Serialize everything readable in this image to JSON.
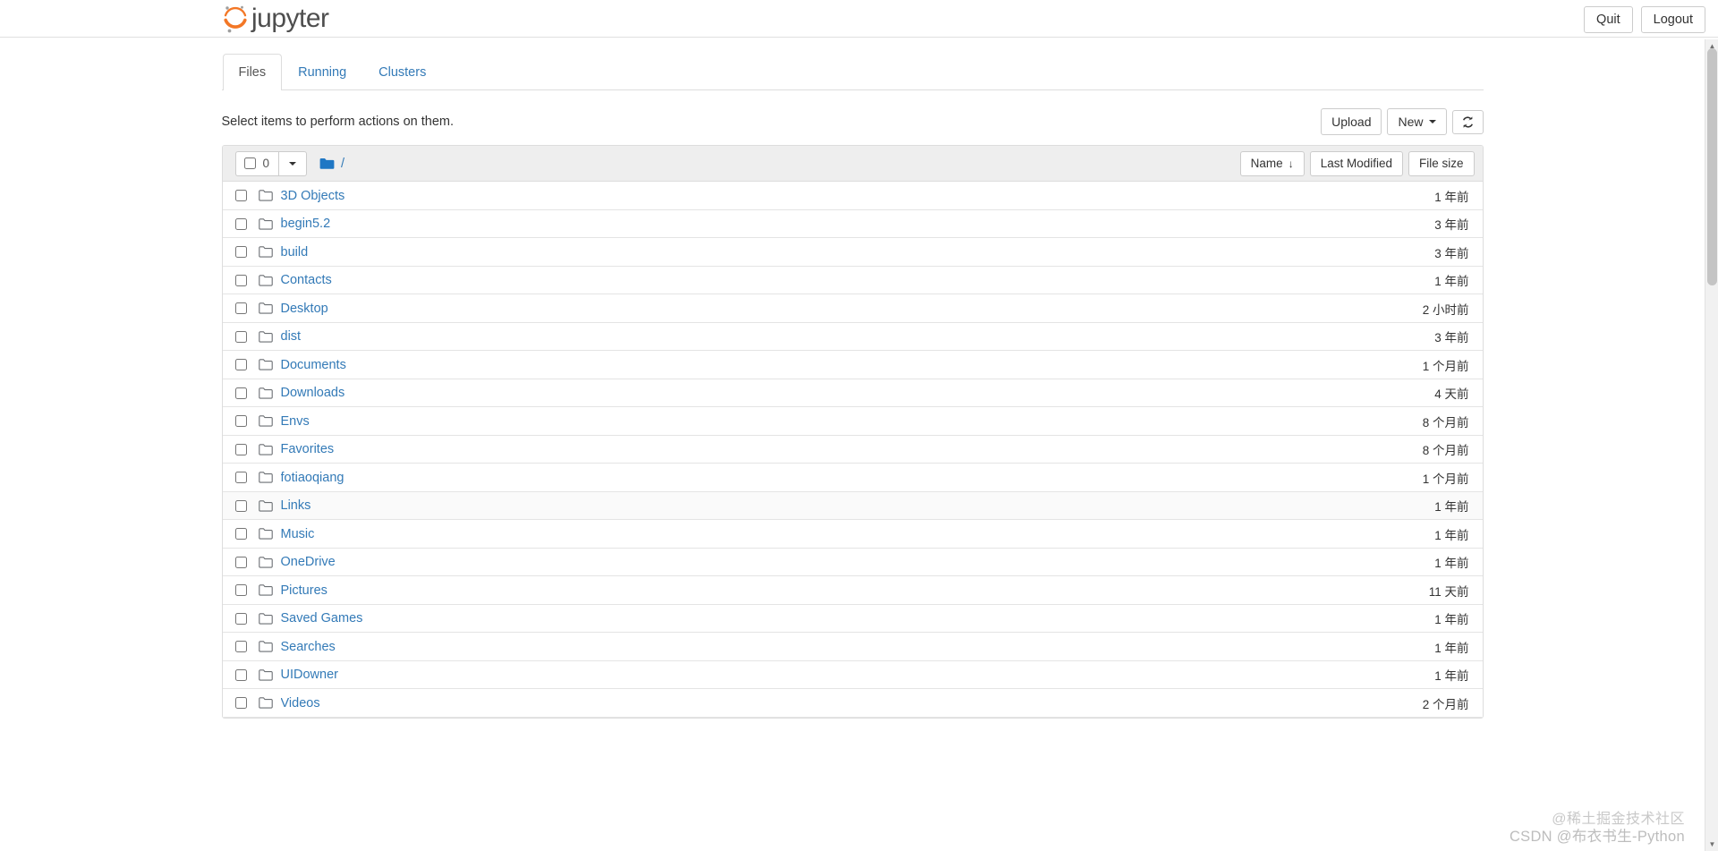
{
  "header": {
    "brand": "jupyter",
    "logo_icon": "jupyter-logo-icon",
    "logo_color": "#f37726",
    "logo_dot_color": "#9e9e9e",
    "quit_label": "Quit",
    "logout_label": "Logout"
  },
  "tabs": [
    {
      "label": "Files",
      "active": true
    },
    {
      "label": "Running",
      "active": false
    },
    {
      "label": "Clusters",
      "active": false
    }
  ],
  "toolbar": {
    "message": "Select items to perform actions on them.",
    "upload_label": "Upload",
    "new_label": "New",
    "new_caret_icon": "chevron-down-icon",
    "refresh_icon": "refresh-icon"
  },
  "list_header": {
    "select_count": "0",
    "select_caret_icon": "chevron-down-icon",
    "folder_icon": "folder-icon",
    "folder_icon_color": "#1f77c4",
    "breadcrumb_root": "/",
    "sort_name_label": "Name",
    "sort_name_arrow": "↓",
    "sort_modified_label": "Last Modified",
    "sort_size_label": "File size"
  },
  "columns": [
    "Name",
    "Last Modified",
    "File size"
  ],
  "files": [
    {
      "name": "3D Objects",
      "icon": "folder-icon",
      "modified": "1 年前",
      "size": ""
    },
    {
      "name": "begin5.2",
      "icon": "folder-icon",
      "modified": "3 年前",
      "size": ""
    },
    {
      "name": "build",
      "icon": "folder-icon",
      "modified": "3 年前",
      "size": ""
    },
    {
      "name": "Contacts",
      "icon": "folder-icon",
      "modified": "1 年前",
      "size": ""
    },
    {
      "name": "Desktop",
      "icon": "folder-icon",
      "modified": "2 小时前",
      "size": ""
    },
    {
      "name": "dist",
      "icon": "folder-icon",
      "modified": "3 年前",
      "size": ""
    },
    {
      "name": "Documents",
      "icon": "folder-icon",
      "modified": "1 个月前",
      "size": ""
    },
    {
      "name": "Downloads",
      "icon": "folder-icon",
      "modified": "4 天前",
      "size": ""
    },
    {
      "name": "Envs",
      "icon": "folder-icon",
      "modified": "8 个月前",
      "size": ""
    },
    {
      "name": "Favorites",
      "icon": "folder-icon",
      "modified": "8 个月前",
      "size": ""
    },
    {
      "name": "fotiaoqiang",
      "icon": "folder-icon",
      "modified": "1 个月前",
      "size": ""
    },
    {
      "name": "Links",
      "icon": "folder-icon",
      "modified": "1 年前",
      "size": "",
      "highlighted": true
    },
    {
      "name": "Music",
      "icon": "folder-icon",
      "modified": "1 年前",
      "size": ""
    },
    {
      "name": "OneDrive",
      "icon": "folder-icon",
      "modified": "1 年前",
      "size": ""
    },
    {
      "name": "Pictures",
      "icon": "folder-icon",
      "modified": "11 天前",
      "size": ""
    },
    {
      "name": "Saved Games",
      "icon": "folder-icon",
      "modified": "1 年前",
      "size": ""
    },
    {
      "name": "Searches",
      "icon": "folder-icon",
      "modified": "1 年前",
      "size": ""
    },
    {
      "name": "UIDowner",
      "icon": "folder-icon",
      "modified": "1 年前",
      "size": ""
    },
    {
      "name": "Videos",
      "icon": "folder-icon",
      "modified": "2 个月前",
      "size": ""
    }
  ],
  "watermark": {
    "line1": "@稀土掘金技术社区",
    "line2": "CSDN @布衣书生-Python"
  }
}
